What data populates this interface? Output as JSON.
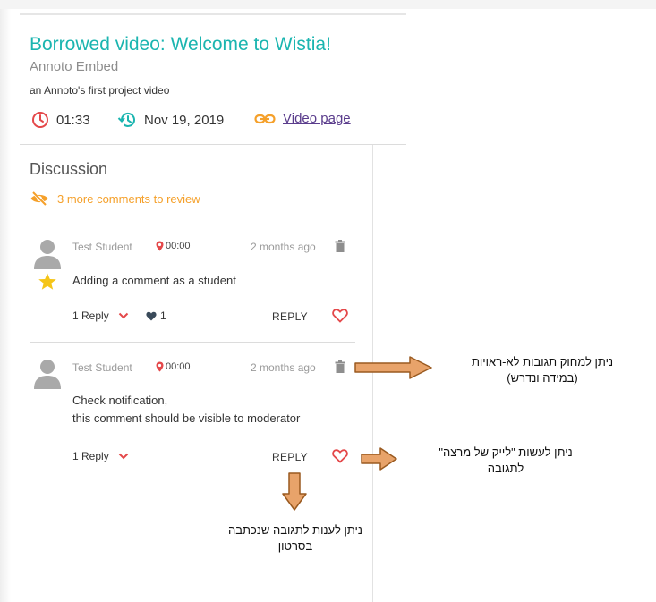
{
  "video": {
    "title": "Borrowed video: Welcome to Wistia!",
    "subtitle": "Annoto Embed",
    "description": "an Annoto's first project video",
    "duration": "01:33",
    "date": "Nov 19, 2019",
    "link_label": "Video page"
  },
  "discussion": {
    "title": "Discussion",
    "review_notice": "3 more comments to review"
  },
  "comments": [
    {
      "author": "Test Student",
      "timestamp": "00:00",
      "ago": "2 months ago",
      "text_line1": "Adding a comment as a student",
      "replies": "1 Reply",
      "likes": "1",
      "reply_label": "REPLY"
    },
    {
      "author": "Test Student",
      "timestamp": "00:00",
      "ago": "2 months ago",
      "text_line1": "Check notification,",
      "text_line2": "this comment should be visible to moderator",
      "replies": "1 Reply",
      "reply_label": "REPLY"
    }
  ],
  "annotations": {
    "delete_note_line1": "ניתן למחוק תגובות לא-ראויות",
    "delete_note_line2": "(במידה ונדרש)",
    "like_note_line1": "ניתן לעשות \"לייק של מרצה\"",
    "like_note_line2": "לתגובה",
    "reply_note_line1": "ניתן לענות לתגובה שנכתבה",
    "reply_note_line2": "בסרטון"
  },
  "icons": {
    "clock": "clock-icon",
    "history": "history-icon",
    "link": "link-icon",
    "hidden": "eye-off-icon",
    "avatar": "user-avatar-icon",
    "star": "star-icon",
    "pin": "location-pin-icon",
    "trash": "trash-icon",
    "chevron": "chevron-down-icon",
    "heart_filled": "heart-icon",
    "heart_outline": "heart-outline-icon",
    "arrow": "arrow-icon"
  },
  "colors": {
    "title": "#1bb5b0",
    "accent_red": "#e4484a",
    "accent_orange": "#f5a02a",
    "arrow_fill": "#e8a36a",
    "arrow_stroke": "#9a5a20",
    "star": "#f5c518"
  }
}
